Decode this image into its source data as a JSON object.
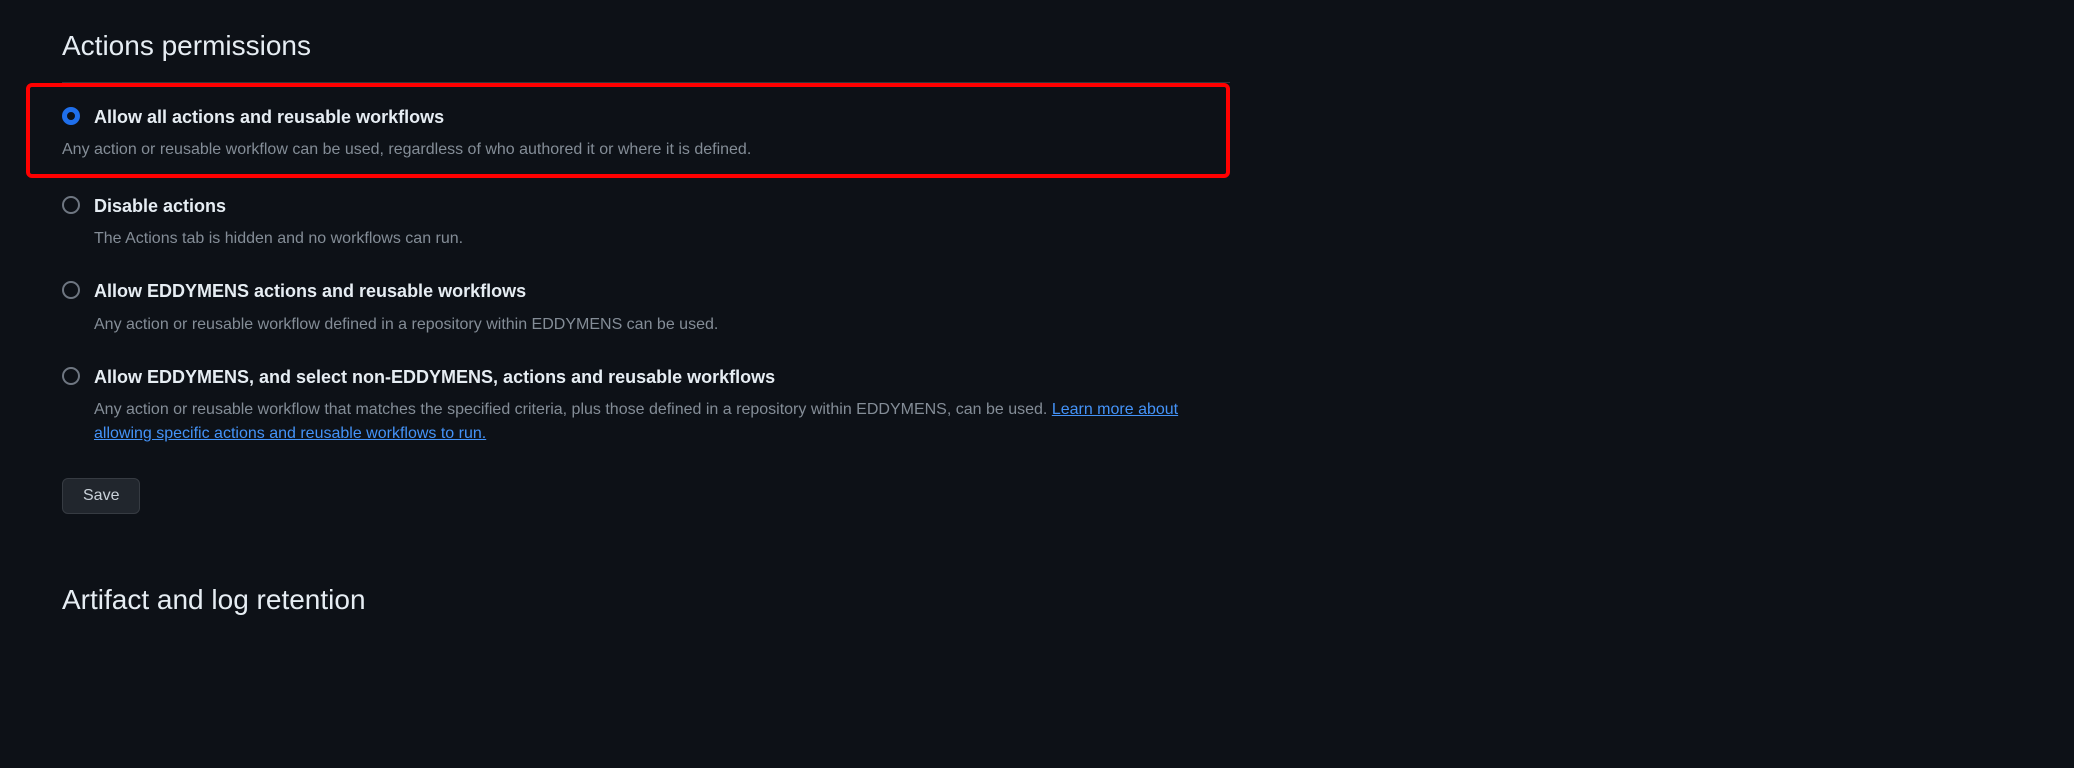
{
  "section1": {
    "title": "Actions permissions",
    "options": [
      {
        "label": "Allow all actions and reusable workflows",
        "description": "Any action or reusable workflow can be used, regardless of who authored it or where it is defined.",
        "selected": true
      },
      {
        "label": "Disable actions",
        "description": "The Actions tab is hidden and no workflows can run.",
        "selected": false
      },
      {
        "label": "Allow EDDYMENS actions and reusable workflows",
        "description": "Any action or reusable workflow defined in a repository within EDDYMENS can be used.",
        "selected": false
      },
      {
        "label": "Allow EDDYMENS, and select non-EDDYMENS, actions and reusable workflows",
        "description_prefix": "Any action or reusable workflow that matches the specified criteria, plus those defined in a repository within EDDYMENS, can be used. ",
        "link_text": "Learn more about allowing specific actions and reusable workflows to run.",
        "selected": false
      }
    ],
    "save_label": "Save"
  },
  "section2": {
    "title": "Artifact and log retention"
  }
}
